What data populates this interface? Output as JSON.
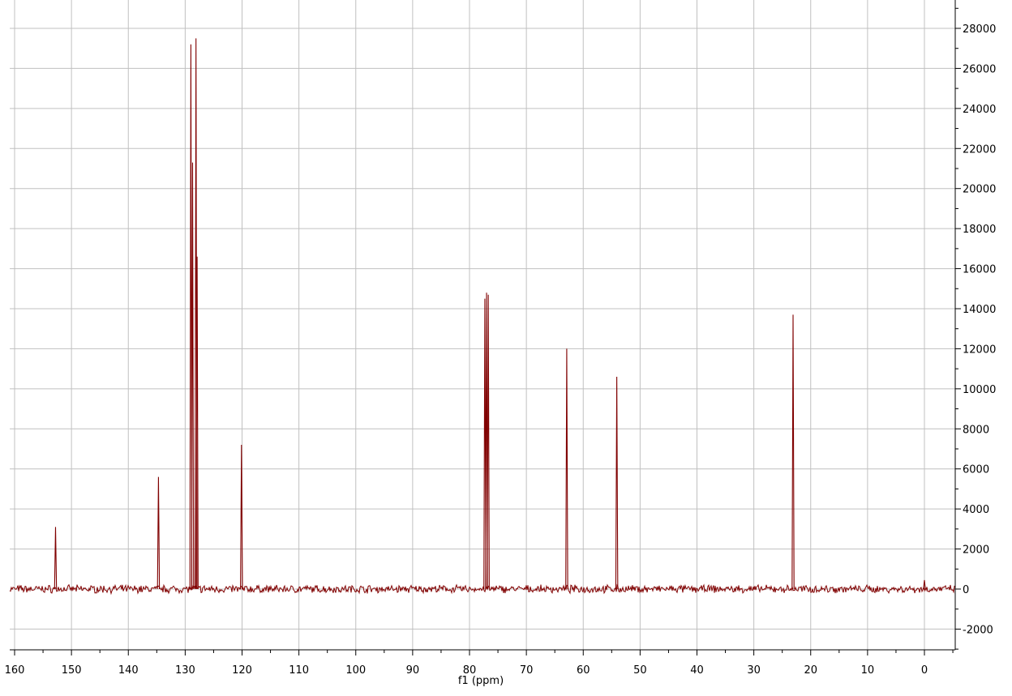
{
  "chart_data": {
    "type": "line",
    "title": "",
    "xlabel": "f1 (ppm)",
    "ylabel": "",
    "x_reversed": true,
    "xlim": [
      161,
      -5
    ],
    "ylim": [
      -3000,
      29000
    ],
    "x_ticks": [
      160,
      150,
      140,
      130,
      120,
      110,
      100,
      90,
      80,
      70,
      60,
      50,
      40,
      30,
      20,
      10,
      0
    ],
    "x_tick_labels": [
      "160",
      "150",
      "140",
      "130",
      "120",
      "110",
      "100",
      "90",
      "80",
      "70",
      "60",
      "50",
      "40",
      "30",
      "20",
      "10",
      "0"
    ],
    "y_ticks": [
      -2000,
      0,
      2000,
      4000,
      6000,
      8000,
      10000,
      12000,
      14000,
      16000,
      18000,
      20000,
      22000,
      24000,
      26000,
      28000
    ],
    "y_tick_labels": [
      "-2000",
      "0",
      "2000",
      "4000",
      "6000",
      "8000",
      "10000",
      "12000",
      "14000",
      "16000",
      "18000",
      "20000",
      "22000",
      "24000",
      "26000",
      "28000"
    ],
    "y_axis_side": "right",
    "grid": true,
    "legend": "none",
    "baseline_noise": 150,
    "peaks": [
      {
        "x": 152.8,
        "y": 3100
      },
      {
        "x": 134.7,
        "y": 5600
      },
      {
        "x": 129.0,
        "y": 27200
      },
      {
        "x": 128.7,
        "y": 21300
      },
      {
        "x": 128.1,
        "y": 27500
      },
      {
        "x": 127.9,
        "y": 16600
      },
      {
        "x": 120.1,
        "y": 7200
      },
      {
        "x": 77.3,
        "y": 14500
      },
      {
        "x": 77.0,
        "y": 14800
      },
      {
        "x": 76.7,
        "y": 14700
      },
      {
        "x": 62.9,
        "y": 12000
      },
      {
        "x": 54.1,
        "y": 10600
      },
      {
        "x": 23.1,
        "y": 13700
      },
      {
        "x": 0.0,
        "y": 450
      }
    ],
    "colors": {
      "line": "#800000",
      "grid": "#c0c0c0",
      "axis": "#000000",
      "background": "#ffffff"
    }
  }
}
